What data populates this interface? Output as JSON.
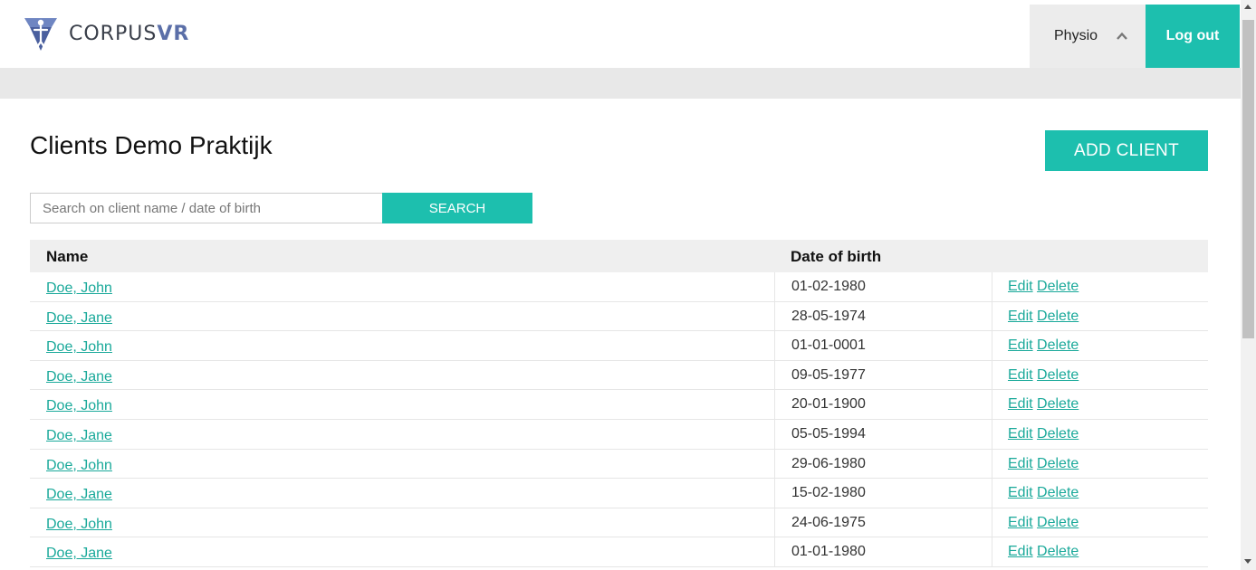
{
  "brand": {
    "name_plain": "CORPUS",
    "name_bold": "VR"
  },
  "header": {
    "user_label": "Physio",
    "logout_label": "Log out"
  },
  "page": {
    "title": "Clients Demo Praktijk",
    "add_client_label": "ADD CLIENT"
  },
  "search": {
    "placeholder": "Search on client name / date of birth",
    "value": "",
    "button_label": "SEARCH"
  },
  "table": {
    "columns": [
      "Name",
      "Date of birth"
    ],
    "edit_label": "Edit",
    "delete_label": "Delete",
    "rows": [
      {
        "name": "Doe, John",
        "dob": "01-02-1980"
      },
      {
        "name": "Doe, Jane",
        "dob": "28-05-1974"
      },
      {
        "name": "Doe, John",
        "dob": "01-01-0001"
      },
      {
        "name": "Doe, Jane",
        "dob": "09-05-1977"
      },
      {
        "name": "Doe, John",
        "dob": "20-01-1900"
      },
      {
        "name": "Doe, Jane",
        "dob": "05-05-1994"
      },
      {
        "name": "Doe, John",
        "dob": "29-06-1980"
      },
      {
        "name": "Doe, Jane",
        "dob": "15-02-1980"
      },
      {
        "name": "Doe, John",
        "dob": "24-06-1975"
      },
      {
        "name": "Doe, Jane",
        "dob": "01-01-1980"
      }
    ]
  },
  "colors": {
    "accent": "#1dbfae",
    "link": "#1aa99a",
    "brand_blue": "#5b6fa8"
  },
  "icons": {
    "logo": "corpusvr-logo-icon",
    "user_menu": "chevron-up-icon"
  }
}
